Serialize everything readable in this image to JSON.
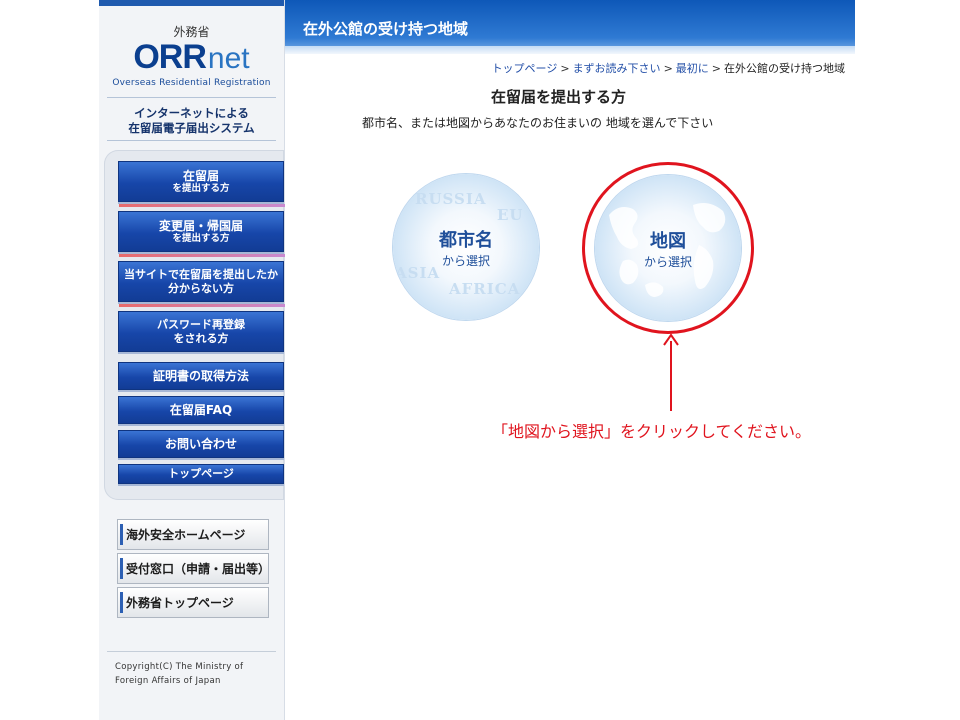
{
  "sidebar": {
    "ministry": "外務省",
    "logo_main": "ORR",
    "logo_suffix": "net",
    "logo_subtitle": "Overseas Residential Registration",
    "system_name_1": "インターネットによる",
    "system_name_2": "在留届電子届出システム",
    "nav": [
      {
        "line1": "在留届",
        "line2": "を提出する方"
      },
      {
        "line1": "変更届・帰国届",
        "line2": "を提出する方"
      },
      {
        "line1": "当サイトで在留届を提出したか",
        "line2": "分からない方"
      },
      {
        "line1": "パスワード再登録",
        "line2": "をされる方"
      },
      {
        "line1": "証明書の取得方法"
      },
      {
        "line1": "在留届FAQ"
      },
      {
        "line1": "お問い合わせ"
      },
      {
        "line1": "トップページ"
      }
    ],
    "external_links": [
      "海外安全ホームページ",
      "受付窓口（申請・届出等）",
      "外務省トップページ"
    ],
    "copyright_1": "Copyright(C)  The Ministry of",
    "copyright_2": "Foreign Affairs of Japan"
  },
  "header": {
    "title": "在外公館の受け持つ地域"
  },
  "breadcrumb": {
    "items": [
      "トップページ",
      "まずお読み下さい",
      "最初に"
    ],
    "current": "在外公館の受け持つ地域",
    "separator": ">"
  },
  "main": {
    "section_title": "在留届を提出する方",
    "instruction": "都市名、または地図からあなたのお住まいの 地域を選んで下さい",
    "city_option": {
      "label": "都市名",
      "sub": "から選択",
      "bg_words": [
        "RUSSIA",
        "EU",
        "ASIA",
        "AFRICA"
      ]
    },
    "map_option": {
      "label": "地図",
      "sub": "から選択"
    },
    "annotation": "「地図から選択」をクリックしてください。"
  },
  "colors": {
    "accent": "#1746a9",
    "highlight": "#e0141e",
    "header": "#0e58b8"
  }
}
